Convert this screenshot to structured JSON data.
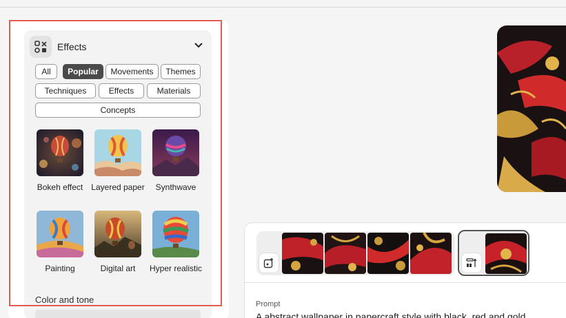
{
  "effects_panel": {
    "title": "Effects",
    "icon": "effects-icon",
    "filters": [
      {
        "label": "All",
        "active": false
      },
      {
        "label": "Popular",
        "active": true
      },
      {
        "label": "Movements",
        "active": false
      },
      {
        "label": "Themes",
        "active": false
      },
      {
        "label": "Techniques",
        "active": false
      },
      {
        "label": "Effects",
        "active": false
      },
      {
        "label": "Materials",
        "active": false
      },
      {
        "label": "Concepts",
        "active": false
      }
    ],
    "styles": [
      {
        "label": "Bokeh effect"
      },
      {
        "label": "Layered paper"
      },
      {
        "label": "Synthwave"
      },
      {
        "label": "Painting"
      },
      {
        "label": "Digital art"
      },
      {
        "label": "Hyper realistic"
      }
    ],
    "next_section": "Color and tone"
  },
  "bottom": {
    "prompt_label": "Prompt",
    "prompt_text": "A abstract wallpaper in papercraft style with black, red and gold"
  },
  "colors": {
    "accent_highlight": "#e25b4f",
    "active_pill": "#4a4a4a"
  }
}
